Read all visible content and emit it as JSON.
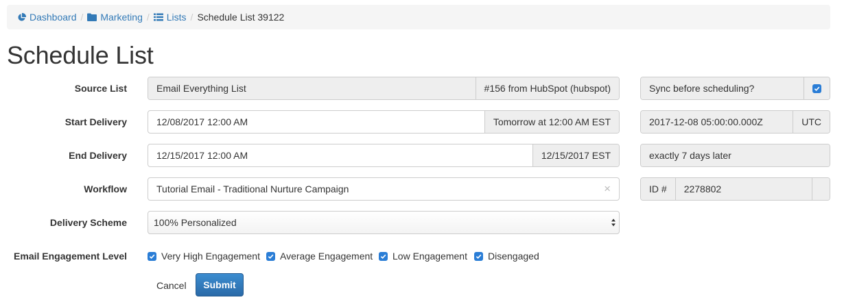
{
  "breadcrumb": {
    "dashboard": "Dashboard",
    "marketing": "Marketing",
    "lists": "Lists",
    "current": "Schedule List 39122",
    "separator": "/"
  },
  "page": {
    "title": "Schedule List"
  },
  "form": {
    "source_list": {
      "label": "Source List",
      "value": "Email Everything List",
      "addon": "#156 from HubSpot (hubspot)",
      "sync_label": "Sync before scheduling?",
      "sync_checked": true
    },
    "start_delivery": {
      "label": "Start Delivery",
      "value": "12/08/2017 12:00 AM",
      "addon": "Tomorrow at 12:00 AM EST",
      "utc_value": "2017-12-08 05:00:00.000Z",
      "utc_addon": "UTC"
    },
    "end_delivery": {
      "label": "End Delivery",
      "value": "12/15/2017 12:00 AM",
      "addon": "12/15/2017 EST",
      "relative": "exactly 7 days later"
    },
    "workflow": {
      "label": "Workflow",
      "value": "Tutorial Email - Traditional Nurture Campaign",
      "clear": "×",
      "id_label": "ID #",
      "id_value": "2278802"
    },
    "delivery_scheme": {
      "label": "Delivery Scheme",
      "value": "100% Personalized"
    },
    "engagement": {
      "label": "Email Engagement Level",
      "options": [
        "Very High Engagement",
        "Average Engagement",
        "Low Engagement",
        "Disengaged"
      ]
    }
  },
  "actions": {
    "cancel": "Cancel",
    "submit": "Submit"
  },
  "colors": {
    "link": "#337ab7",
    "primary": "#2a6aa8",
    "checkbox": "#2a7dd6"
  }
}
